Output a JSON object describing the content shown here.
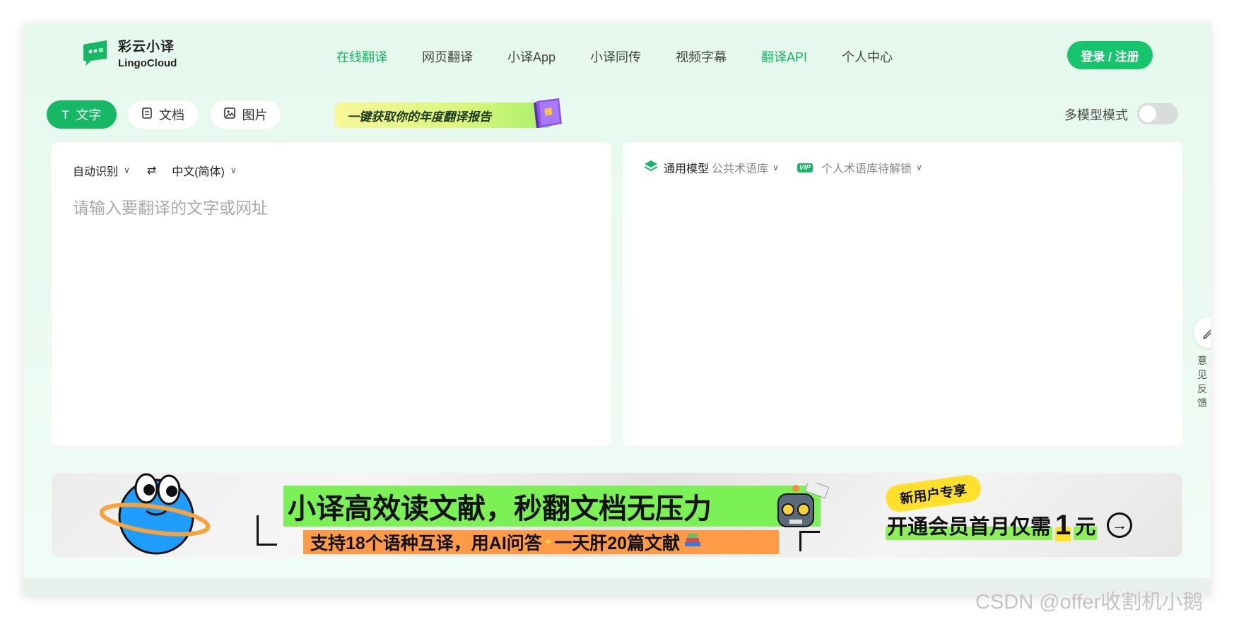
{
  "brand": {
    "name_cn": "彩云小译",
    "name_en": "LingoCloud",
    "accent": "#16b765"
  },
  "nav": [
    {
      "label": "在线翻译",
      "active": true
    },
    {
      "label": "网页翻译",
      "active": false
    },
    {
      "label": "小译App",
      "active": false
    },
    {
      "label": "小译同传",
      "active": false
    },
    {
      "label": "视频字幕",
      "active": false
    },
    {
      "label": "翻译API",
      "active": true
    },
    {
      "label": "个人中心",
      "active": false
    }
  ],
  "login_label": "登录 / 注册",
  "tabs": [
    {
      "label": "文字",
      "icon": "text-icon",
      "active": true
    },
    {
      "label": "文档",
      "icon": "document-icon",
      "active": false
    },
    {
      "label": "图片",
      "icon": "image-icon",
      "active": false
    }
  ],
  "promo_label": "一键获取你的年度翻译报告",
  "multi_model": {
    "label": "多模型模式",
    "enabled": false
  },
  "source": {
    "from_lang": "自动识别",
    "to_lang": "中文(简体)",
    "placeholder": "请输入要翻译的文字或网址",
    "value": ""
  },
  "target": {
    "model_label": "通用模型",
    "glossary_label": "公共术语库",
    "vip_badge": "VIP",
    "personal_glossary_label": "个人术语库待解锁"
  },
  "feedback_label": "意见反馈",
  "banner": {
    "headline": "小译高效读文献，秒翻文档无压力",
    "sub": "支持18个语种互译，用AI问答",
    "sub2": "一天肝20篇文献",
    "badge": "新用户专享",
    "cta_part1": "开通会员首月仅需",
    "cta_price": "1",
    "cta_unit": "元"
  },
  "watermark": "CSDN @offer收割机小鹅"
}
